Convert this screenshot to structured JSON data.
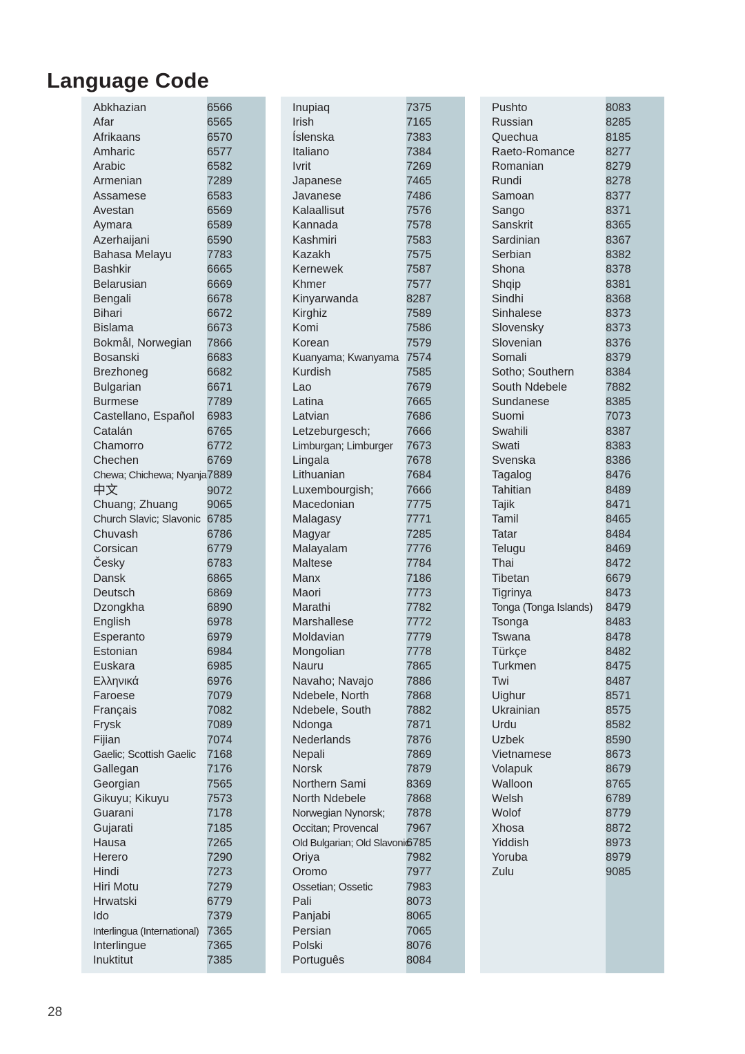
{
  "document": {
    "title": "Language Code",
    "page_number": "28",
    "colors": {
      "band_light": "#e3ebef",
      "band_dark": "#bccfd5",
      "text": "#231f20"
    }
  },
  "columns": [
    {
      "id": "column-1",
      "rows": [
        {
          "name": "Abkhazian",
          "code": "6566"
        },
        {
          "name": "Afar",
          "code": "6565"
        },
        {
          "name": "Afrikaans",
          "code": "6570"
        },
        {
          "name": "Amharic",
          "code": "6577"
        },
        {
          "name": "Arabic",
          "code": "6582"
        },
        {
          "name": "Armenian",
          "code": "7289"
        },
        {
          "name": "Assamese",
          "code": "6583"
        },
        {
          "name": "Avestan",
          "code": "6569"
        },
        {
          "name": "Aymara",
          "code": "6589"
        },
        {
          "name": "Azerhaijani",
          "code": "6590"
        },
        {
          "name": "Bahasa Melayu",
          "code": "7783"
        },
        {
          "name": "Bashkir",
          "code": "6665"
        },
        {
          "name": "Belarusian",
          "code": "6669"
        },
        {
          "name": "Bengali",
          "code": "6678"
        },
        {
          "name": "Bihari",
          "code": "6672"
        },
        {
          "name": "Bislama",
          "code": "6673"
        },
        {
          "name": "Bokmål, Norwegian",
          "code": "7866"
        },
        {
          "name": "Bosanski",
          "code": "6683"
        },
        {
          "name": "Brezhoneg",
          "code": "6682"
        },
        {
          "name": "Bulgarian",
          "code": "6671"
        },
        {
          "name": "Burmese",
          "code": "7789"
        },
        {
          "name": "Castellano, Español",
          "code": "6983"
        },
        {
          "name": "Catalán",
          "code": "6765"
        },
        {
          "name": "Chamorro",
          "code": "6772"
        },
        {
          "name": "Chechen",
          "code": "6769"
        },
        {
          "name": "Chewa; Chichewa; Nyanja",
          "code": "7889",
          "fit": "very-tight"
        },
        {
          "name": "中文",
          "code": "9072",
          "script": "cjk"
        },
        {
          "name": "Chuang; Zhuang",
          "code": "9065"
        },
        {
          "name": "Church Slavic; Slavonic",
          "code": "6785",
          "fit": "tight"
        },
        {
          "name": "Chuvash",
          "code": "6786"
        },
        {
          "name": "Corsican",
          "code": "6779"
        },
        {
          "name": "Česky",
          "code": "6783"
        },
        {
          "name": "Dansk",
          "code": "6865"
        },
        {
          "name": "Deutsch",
          "code": "6869"
        },
        {
          "name": "Dzongkha",
          "code": "6890"
        },
        {
          "name": "English",
          "code": "6978"
        },
        {
          "name": "Esperanto",
          "code": "6979"
        },
        {
          "name": "Estonian",
          "code": "6984"
        },
        {
          "name": "Euskara",
          "code": "6985"
        },
        {
          "name": "Ελληνικά",
          "code": "6976"
        },
        {
          "name": "Faroese",
          "code": "7079"
        },
        {
          "name": "Français",
          "code": "7082"
        },
        {
          "name": "Frysk",
          "code": "7089"
        },
        {
          "name": "Fijian",
          "code": "7074"
        },
        {
          "name": "Gaelic; Scottish Gaelic",
          "code": "7168",
          "fit": "tight"
        },
        {
          "name": "Gallegan",
          "code": "7176"
        },
        {
          "name": "Georgian",
          "code": "7565"
        },
        {
          "name": "Gikuyu; Kikuyu",
          "code": "7573"
        },
        {
          "name": "Guarani",
          "code": "7178"
        },
        {
          "name": "Gujarati",
          "code": "7185"
        },
        {
          "name": "Hausa",
          "code": "7265"
        },
        {
          "name": "Herero",
          "code": "7290"
        },
        {
          "name": "Hindi",
          "code": "7273"
        },
        {
          "name": "Hiri Motu",
          "code": "7279"
        },
        {
          "name": "Hrwatski",
          "code": "6779"
        },
        {
          "name": "Ido",
          "code": "7379"
        },
        {
          "name": "Interlingua (International)",
          "code": "7365",
          "fit": "very-tight"
        },
        {
          "name": "Interlingue",
          "code": "7365"
        },
        {
          "name": "Inuktitut",
          "code": "7385"
        }
      ]
    },
    {
      "id": "column-2",
      "rows": [
        {
          "name": "Inupiaq",
          "code": "7375"
        },
        {
          "name": "Irish",
          "code": "7165"
        },
        {
          "name": "Íslenska",
          "code": "7383"
        },
        {
          "name": "Italiano",
          "code": "7384"
        },
        {
          "name": "Ivrit",
          "code": "7269"
        },
        {
          "name": "Japanese",
          "code": "7465"
        },
        {
          "name": "Javanese",
          "code": "7486"
        },
        {
          "name": "Kalaallisut",
          "code": "7576"
        },
        {
          "name": "Kannada",
          "code": "7578"
        },
        {
          "name": "Kashmiri",
          "code": "7583"
        },
        {
          "name": "Kazakh",
          "code": "7575"
        },
        {
          "name": "Kernewek",
          "code": "7587"
        },
        {
          "name": "Khmer",
          "code": "7577"
        },
        {
          "name": "Kinyarwanda",
          "code": "8287"
        },
        {
          "name": "Kirghiz",
          "code": "7589"
        },
        {
          "name": "Komi",
          "code": "7586"
        },
        {
          "name": "Korean",
          "code": "7579"
        },
        {
          "name": "Kuanyama; Kwanyama",
          "code": "7574",
          "fit": "tight"
        },
        {
          "name": "Kurdish",
          "code": "7585"
        },
        {
          "name": "Lao",
          "code": "7679"
        },
        {
          "name": "Latina",
          "code": "7665"
        },
        {
          "name": "Latvian",
          "code": "7686"
        },
        {
          "name": "Letzeburgesch;",
          "code": "7666"
        },
        {
          "name": "Limburgan; Limburger",
          "code": "7673",
          "fit": "tight"
        },
        {
          "name": "Lingala",
          "code": "7678"
        },
        {
          "name": "Lithuanian",
          "code": "7684"
        },
        {
          "name": "Luxembourgish;",
          "code": "7666"
        },
        {
          "name": "Macedonian",
          "code": "7775"
        },
        {
          "name": "Malagasy",
          "code": "7771"
        },
        {
          "name": "Magyar",
          "code": "7285"
        },
        {
          "name": "Malayalam",
          "code": "7776"
        },
        {
          "name": "Maltese",
          "code": "7784"
        },
        {
          "name": "Manx",
          "code": "7186"
        },
        {
          "name": "Maori",
          "code": "7773"
        },
        {
          "name": "Marathi",
          "code": "7782"
        },
        {
          "name": "Marshallese",
          "code": "7772"
        },
        {
          "name": "Moldavian",
          "code": "7779"
        },
        {
          "name": "Mongolian",
          "code": "7778"
        },
        {
          "name": "Nauru",
          "code": "7865"
        },
        {
          "name": "Navaho; Navajo",
          "code": "7886"
        },
        {
          "name": "Ndebele, North",
          "code": "7868"
        },
        {
          "name": "Ndebele, South",
          "code": "7882"
        },
        {
          "name": "Ndonga",
          "code": "7871"
        },
        {
          "name": "Nederlands",
          "code": "7876"
        },
        {
          "name": "Nepali",
          "code": "7869"
        },
        {
          "name": "Norsk",
          "code": "7879"
        },
        {
          "name": "Northern Sami",
          "code": "8369"
        },
        {
          "name": "North Ndebele",
          "code": "7868"
        },
        {
          "name": "Norwegian Nynorsk;",
          "code": "7878",
          "fit": "tight"
        },
        {
          "name": "Occitan; Provencal",
          "code": "7967",
          "fit": "tight"
        },
        {
          "name": "Old Bulgarian; Old Slavonic",
          "code": "6785",
          "fit": "very-tight"
        },
        {
          "name": "Oriya",
          "code": "7982"
        },
        {
          "name": "Oromo",
          "code": "7977"
        },
        {
          "name": "Ossetian; Ossetic",
          "code": "7983",
          "fit": "tight"
        },
        {
          "name": "Pali",
          "code": "8073"
        },
        {
          "name": "Panjabi",
          "code": "8065"
        },
        {
          "name": "Persian",
          "code": "7065"
        },
        {
          "name": "Polski",
          "code": "8076"
        },
        {
          "name": "Português",
          "code": "8084"
        }
      ]
    },
    {
      "id": "column-3",
      "rows": [
        {
          "name": "Pushto",
          "code": "8083"
        },
        {
          "name": "Russian",
          "code": "8285"
        },
        {
          "name": "Quechua",
          "code": "8185"
        },
        {
          "name": "Raeto-Romance",
          "code": "8277"
        },
        {
          "name": "Romanian",
          "code": "8279"
        },
        {
          "name": "Rundi",
          "code": "8278"
        },
        {
          "name": "Samoan",
          "code": "8377"
        },
        {
          "name": "Sango",
          "code": "8371"
        },
        {
          "name": "Sanskrit",
          "code": "8365"
        },
        {
          "name": "Sardinian",
          "code": "8367"
        },
        {
          "name": "Serbian",
          "code": "8382"
        },
        {
          "name": "Shona",
          "code": "8378"
        },
        {
          "name": "Shqip",
          "code": "8381"
        },
        {
          "name": "Sindhi",
          "code": "8368"
        },
        {
          "name": "Sinhalese",
          "code": "8373"
        },
        {
          "name": "Slovensky",
          "code": "8373"
        },
        {
          "name": "Slovenian",
          "code": "8376"
        },
        {
          "name": "Somali",
          "code": "8379"
        },
        {
          "name": "Sotho; Southern",
          "code": "8384"
        },
        {
          "name": "South Ndebele",
          "code": "7882"
        },
        {
          "name": "Sundanese",
          "code": "8385"
        },
        {
          "name": "Suomi",
          "code": "7073"
        },
        {
          "name": "Swahili",
          "code": "8387"
        },
        {
          "name": "Swati",
          "code": "8383"
        },
        {
          "name": "Svenska",
          "code": "8386"
        },
        {
          "name": "Tagalog",
          "code": "8476"
        },
        {
          "name": "Tahitian",
          "code": "8489"
        },
        {
          "name": "Tajik",
          "code": "8471"
        },
        {
          "name": "Tamil",
          "code": "8465"
        },
        {
          "name": "Tatar",
          "code": "8484"
        },
        {
          "name": "Telugu",
          "code": "8469"
        },
        {
          "name": "Thai",
          "code": "8472"
        },
        {
          "name": "Tibetan",
          "code": "6679"
        },
        {
          "name": "Tigrinya",
          "code": "8473"
        },
        {
          "name": "Tonga (Tonga Islands)",
          "code": "8479",
          "fit": "tight"
        },
        {
          "name": "Tsonga",
          "code": "8483"
        },
        {
          "name": "Tswana",
          "code": "8478"
        },
        {
          "name": "Türkçe",
          "code": "8482"
        },
        {
          "name": "Turkmen",
          "code": "8475"
        },
        {
          "name": "Twi",
          "code": "8487"
        },
        {
          "name": "Uighur",
          "code": "8571"
        },
        {
          "name": "Ukrainian",
          "code": "8575"
        },
        {
          "name": "Urdu",
          "code": "8582"
        },
        {
          "name": "Uzbek",
          "code": "8590"
        },
        {
          "name": "Vietnamese",
          "code": "8673"
        },
        {
          "name": "Volapuk",
          "code": "8679"
        },
        {
          "name": "Walloon",
          "code": "8765"
        },
        {
          "name": "Welsh",
          "code": "6789"
        },
        {
          "name": "Wolof",
          "code": "8779"
        },
        {
          "name": "Xhosa",
          "code": "8872"
        },
        {
          "name": "Yiddish",
          "code": "8973"
        },
        {
          "name": "Yoruba",
          "code": "8979"
        },
        {
          "name": "Zulu",
          "code": "9085"
        }
      ]
    }
  ]
}
